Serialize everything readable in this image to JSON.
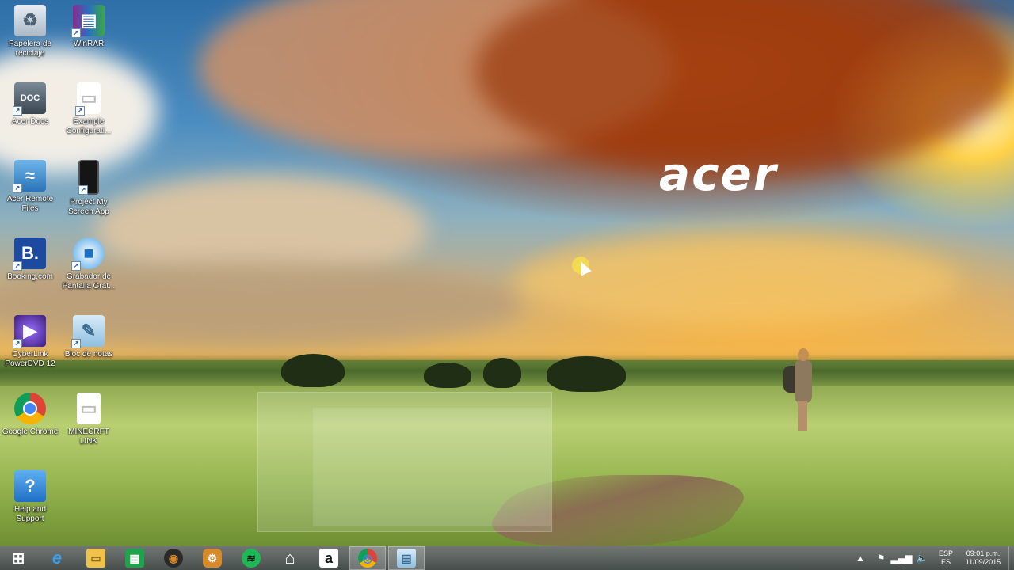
{
  "desktop": {
    "brand_logo": "acer",
    "icons": [
      {
        "label": "Papelera de reciclaje",
        "icon": "recycle-bin-icon"
      },
      {
        "label": "WinRAR",
        "icon": "winrar-icon"
      },
      {
        "label": "Acer Docs",
        "icon": "acer-docs-icon"
      },
      {
        "label": "Example Configurati...",
        "icon": "file-icon"
      },
      {
        "label": "Acer Remote Files",
        "icon": "acer-remote-files-icon"
      },
      {
        "label": "Project My Screen App",
        "icon": "project-screen-icon"
      },
      {
        "label": "Booking.com",
        "icon": "booking-icon"
      },
      {
        "label": "Grabador de Pantalla Grat...",
        "icon": "screen-recorder-icon"
      },
      {
        "label": "CyberLink PowerDVD 12",
        "icon": "powerdvd-icon"
      },
      {
        "label": "Bloc de notas",
        "icon": "notepad-icon"
      },
      {
        "label": "Google Chrome",
        "icon": "chrome-icon"
      },
      {
        "label": "MINECRFT LINK",
        "icon": "file-icon"
      },
      {
        "label": "Help and Support",
        "icon": "help-icon"
      }
    ]
  },
  "taskbar": {
    "pinned": [
      {
        "name": "start",
        "glyph": "⊞"
      },
      {
        "name": "internet-explorer",
        "glyph": "e"
      },
      {
        "name": "file-explorer",
        "glyph": "▭"
      },
      {
        "name": "store",
        "glyph": "▦"
      },
      {
        "name": "media-player",
        "glyph": "◉"
      },
      {
        "name": "app-manager",
        "glyph": "⚙"
      },
      {
        "name": "spotify",
        "glyph": "≋"
      },
      {
        "name": "home",
        "glyph": "⌂"
      },
      {
        "name": "amazon",
        "glyph": "a"
      },
      {
        "name": "chrome",
        "glyph": "◎"
      },
      {
        "name": "notepad",
        "glyph": "▤"
      }
    ],
    "tray": {
      "lang_top": "ESP",
      "lang_bottom": "ES",
      "time": "09:01 p.m.",
      "date": "11/09/2015"
    }
  },
  "colors": {
    "taskbar": "#5d605a",
    "booking": "#1b4aa0",
    "powerdvd": "#3a1f78",
    "help": "#2a7fd0",
    "spotify": "#1db954"
  }
}
